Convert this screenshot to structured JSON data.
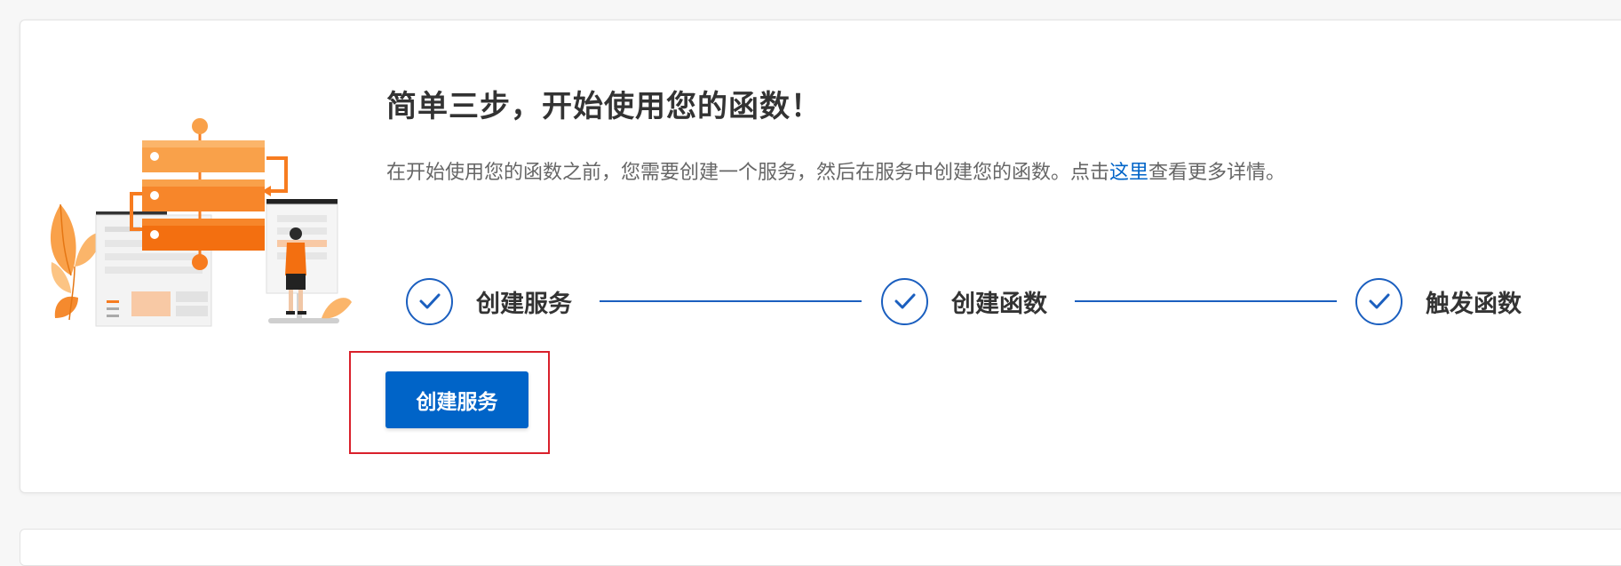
{
  "intro": {
    "title": "简单三步，开始使用您的函数！",
    "description_prefix": "在开始使用您的函数之前，您需要创建一个服务，然后在服务中创建您的函数。点击",
    "description_link": "这里",
    "description_suffix": "查看更多详情。"
  },
  "steps": [
    {
      "label": "创建服务",
      "icon": "check-icon"
    },
    {
      "label": "创建函数",
      "icon": "check-icon"
    },
    {
      "label": "触发函数",
      "icon": "check-icon"
    }
  ],
  "actions": {
    "create_service_label": "创建服务"
  },
  "colors": {
    "primary": "#0064c8",
    "step_accent": "#1b5fbf",
    "illustration_orange": "#f77c20",
    "highlight_red": "#d9202b"
  }
}
